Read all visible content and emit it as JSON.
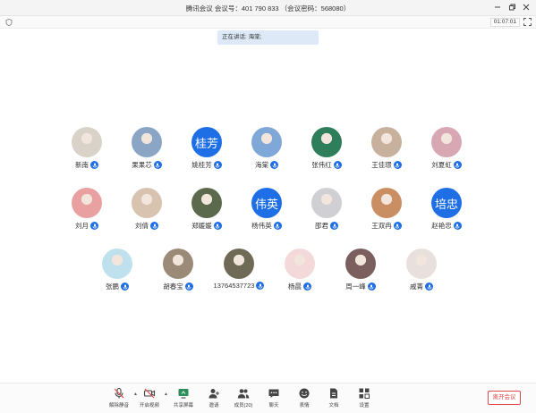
{
  "window": {
    "title": "腾讯会议 会议号：401 790 833 （会议密码：568080）"
  },
  "topbar": {
    "timer": "01:07:01"
  },
  "stage": {
    "speaking": "正在讲话: 海棠;"
  },
  "participants": [
    {
      "name": "新南",
      "avatar_type": "photo",
      "avatar_color": "#d9d2c8",
      "icon": "mic-icon"
    },
    {
      "name": "果果芯",
      "avatar_type": "photo",
      "avatar_color": "#8aa6c4",
      "icon": "mic-icon"
    },
    {
      "name": "姚桂芳",
      "avatar_type": "text",
      "avatar_text": "桂芳",
      "icon": "mic-icon"
    },
    {
      "name": "海棠",
      "avatar_type": "photo",
      "avatar_color": "#7fa7d8",
      "icon": "mic-icon"
    },
    {
      "name": "张伟红",
      "avatar_type": "photo",
      "avatar_color": "#2e7d5b",
      "icon": "mic-icon"
    },
    {
      "name": "王佳璟",
      "avatar_type": "photo",
      "avatar_color": "#c8b19c",
      "icon": "mic-icon"
    },
    {
      "name": "刘夏虹",
      "avatar_type": "photo",
      "avatar_color": "#d8a7b4",
      "icon": "mic-icon"
    },
    {
      "name": "刘月",
      "avatar_type": "photo",
      "avatar_color": "#e9a0a0",
      "icon": "mic-icon"
    },
    {
      "name": "刘倩",
      "avatar_type": "photo",
      "avatar_color": "#d8c2b0",
      "icon": "mic-icon"
    },
    {
      "name": "郑媛媛",
      "avatar_type": "photo",
      "avatar_color": "#5b6a4c",
      "icon": "mic-icon"
    },
    {
      "name": "杨伟英",
      "avatar_type": "text",
      "avatar_text": "伟英",
      "icon": "mic-icon"
    },
    {
      "name": "邵君",
      "avatar_type": "photo",
      "avatar_color": "#cfcfd4",
      "icon": "mic-icon"
    },
    {
      "name": "王双冉",
      "avatar_type": "photo",
      "avatar_color": "#c98f62",
      "icon": "mic-icon"
    },
    {
      "name": "赵艳忠",
      "avatar_type": "text",
      "avatar_text": "培忠",
      "icon": "mic-icon"
    },
    {
      "name": "张鹏",
      "avatar_type": "photo",
      "avatar_color": "#bfe1ee",
      "icon": "mic-icon"
    },
    {
      "name": "胡春宝",
      "avatar_type": "photo",
      "avatar_color": "#9c8a78",
      "icon": "mic-icon"
    },
    {
      "name": "13764537723",
      "avatar_type": "photo",
      "avatar_color": "#6f6a55",
      "icon": "mic-icon"
    },
    {
      "name": "杨晨",
      "avatar_type": "photo",
      "avatar_color": "#f3d9d9",
      "icon": "mic-icon"
    },
    {
      "name": "周一峰",
      "avatar_type": "photo",
      "avatar_color": "#7b5e5e",
      "icon": "mic-icon"
    },
    {
      "name": "戚菁",
      "avatar_type": "photo",
      "avatar_color": "#e8e0dc",
      "icon": "mic-icon"
    }
  ],
  "toolbar": {
    "items": [
      {
        "label": "解除静音",
        "icon": "mic-muted-icon"
      },
      {
        "label": "开启视频",
        "icon": "camera-off-icon"
      },
      {
        "label": "共享屏幕",
        "icon": "share-screen-icon"
      },
      {
        "label": "邀请",
        "icon": "add-user-icon"
      },
      {
        "label": "成员(20)",
        "icon": "members-icon"
      },
      {
        "label": "聊天",
        "icon": "chat-icon"
      },
      {
        "label": "表情",
        "icon": "emoji-icon"
      },
      {
        "label": "文档",
        "icon": "document-icon"
      },
      {
        "label": "设置",
        "icon": "settings-icon"
      }
    ],
    "leave_label": "离开会议"
  },
  "colors": {
    "accent": "#1e6fe6",
    "danger": "#e04c4c",
    "speaking_bg": "#dde9f7"
  }
}
